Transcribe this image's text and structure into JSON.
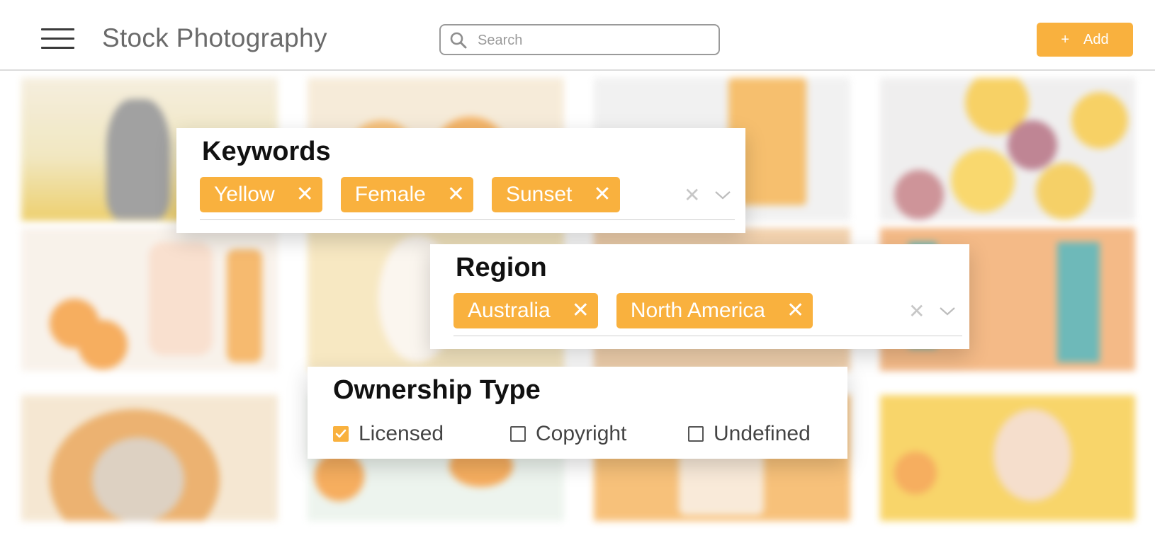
{
  "header": {
    "title": "Stock Photography",
    "search_placeholder": "Search",
    "add_button": {
      "icon": "+",
      "label": "Add"
    }
  },
  "colors": {
    "accent": "#f9b13e",
    "title_text": "#6a6a6a"
  },
  "filters": {
    "keywords": {
      "title": "Keywords",
      "chips": [
        "Yellow",
        "Female",
        "Sunset"
      ],
      "remove_glyph": "✕"
    },
    "region": {
      "title": "Region",
      "chips": [
        "Australia",
        "North America"
      ],
      "remove_glyph": "✕"
    },
    "ownership": {
      "title": "Ownership Type",
      "options": [
        {
          "label": "Licensed",
          "checked": true
        },
        {
          "label": "Copyright",
          "checked": false
        },
        {
          "label": "Undefined",
          "checked": false
        }
      ]
    }
  },
  "icons": {
    "menu": "hamburger-menu-icon",
    "search": "search-icon",
    "clear": "clear-icon",
    "dropdown": "chevron-down-icon",
    "checkbox_checked": "checkmark-icon"
  }
}
